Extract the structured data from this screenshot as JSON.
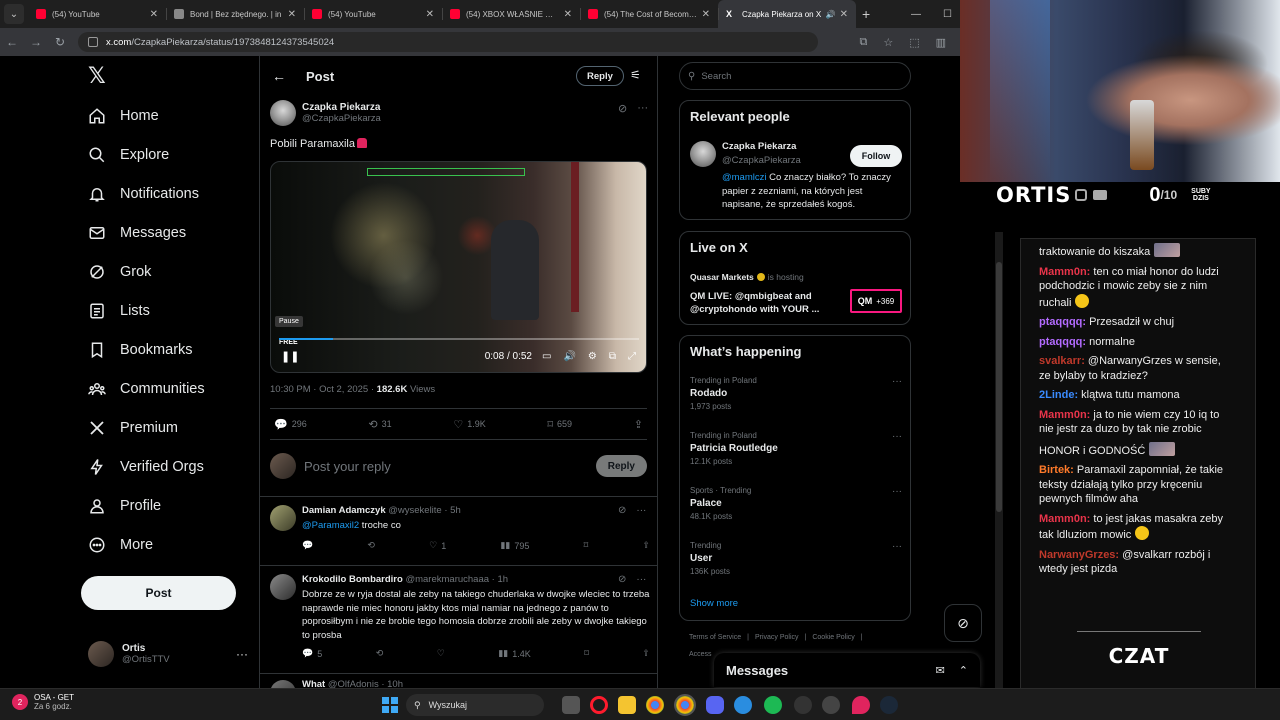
{
  "browser": {
    "tabs": [
      {
        "title": "(54) YouTube",
        "icon": "youtube-icon",
        "active": false
      },
      {
        "title": "Bond | Bez zbędnego. | in",
        "icon": "page-icon",
        "active": false
      },
      {
        "title": "(54) YouTube",
        "icon": "youtube-icon",
        "active": false
      },
      {
        "title": "(54) XBOX WŁAŚNIE WZM",
        "icon": "youtube-icon",
        "active": false
      },
      {
        "title": "(54) The Cost of Becoming",
        "icon": "youtube-icon",
        "active": false
      },
      {
        "title": "Czapka Piekarza on X",
        "icon": "x-icon",
        "active": true
      }
    ],
    "url_host": "x.com",
    "url_path": "/CzapkaPiekarza/status/1973848124373545024"
  },
  "nav": {
    "items": [
      {
        "label": "Home",
        "icon": "home-icon"
      },
      {
        "label": "Explore",
        "icon": "search-icon"
      },
      {
        "label": "Notifications",
        "icon": "bell-icon"
      },
      {
        "label": "Messages",
        "icon": "mail-icon"
      },
      {
        "label": "Grok",
        "icon": "grok-icon"
      },
      {
        "label": "Lists",
        "icon": "list-icon"
      },
      {
        "label": "Bookmarks",
        "icon": "bookmark-icon"
      },
      {
        "label": "Communities",
        "icon": "communities-icon"
      },
      {
        "label": "Premium",
        "icon": "x-icon"
      },
      {
        "label": "Verified Orgs",
        "icon": "lightning-icon"
      },
      {
        "label": "Profile",
        "icon": "person-icon"
      },
      {
        "label": "More",
        "icon": "more-circle-icon"
      }
    ],
    "post_button": "Post",
    "account": {
      "name": "Ortis",
      "handle": "@OrtisTTV"
    }
  },
  "main": {
    "title": "Post",
    "reply_button": "Reply",
    "author": {
      "name": "Czapka Piekarza",
      "handle": "@CzapkaPiekarza"
    },
    "text": "Pobili Paramaxila",
    "video": {
      "tooltip": "Pause",
      "time": "0:08 / 0:52",
      "progress": 0.15,
      "tag": "FREE"
    },
    "meta": {
      "time": "10:30 PM · Oct 2, 2025 · ",
      "views": "182.6K",
      "views_label": " Views"
    },
    "stats": {
      "replies": "296",
      "reposts": "31",
      "likes": "1.9K",
      "bookmarks": "659"
    },
    "composer": {
      "placeholder": "Post your reply",
      "button": "Reply"
    },
    "replies": [
      {
        "name": "Damian Adamczyk",
        "handle": "@wysekelite · 5h",
        "mention": "@Paramaxil2",
        "text": " troche co",
        "likes": "1",
        "views": "795"
      },
      {
        "name": "Krokodilo Bombardiro",
        "handle": "@marekmaruchaaa · 1h",
        "text": "Dobrze ze w ryja dostal ale zeby na takiego chuderlaka w dwojke wleciec to trzeba naprawde nie miec honoru jakby ktos mial namiar na jednego z panów to poprosiłbym i nie ze brobie tego homosia dobrze zrobili ale zeby w dwojke takiego to prosba",
        "replies": "5",
        "views": "1.4K"
      },
      {
        "name": "What",
        "handle": "@OlfAdonis · 10h"
      }
    ]
  },
  "sidebar": {
    "search_placeholder": "Search",
    "relevant": {
      "title": "Relevant people",
      "name": "Czapka Piekarza",
      "handle": "@CzapkaPiekarza",
      "follow": "Follow",
      "bio_mention": "@mamlczi",
      "bio": " Co znaczy białko? To znaczy papier z zezniami, na których jest napisane, że sprzedałeś kogoś."
    },
    "live": {
      "title": "Live on X",
      "host": "Quasar Markets",
      "host_suffix": " is hosting",
      "stream_title": "QM LIVE: @qmbigbeat and @cryptohondo with YOUR ...",
      "listeners": "+369",
      "badge": "QM"
    },
    "happening": {
      "title": "What’s happening",
      "trends": [
        {
          "context": "Trending in Poland",
          "name": "Rodado",
          "count": "1,973 posts"
        },
        {
          "context": "Trending in Poland",
          "name": "Patricia Routledge",
          "count": "12.1K posts"
        },
        {
          "context": "Sports · Trending",
          "name": "Palace",
          "count": "48.1K posts"
        },
        {
          "context": "Trending",
          "name": "User",
          "count": "136K posts"
        }
      ],
      "show_more": "Show more"
    },
    "footer": [
      "Terms of Service",
      "|",
      "Privacy Policy",
      "|",
      "Cookie Policy",
      "|"
    ],
    "footer2": "Access"
  },
  "messages_drawer": {
    "title": "Messages"
  },
  "taskbar": {
    "notify_title": "OSA - GET",
    "notify_sub": "Za 6 godz.",
    "notify_count": "2",
    "search": "Wyszukaj"
  },
  "stream": {
    "name": "ORTIS",
    "subs": "0",
    "goal": "/10",
    "subs_label_1": "SUBY",
    "subs_label_2": "DZIS",
    "chat_title": "CZAT",
    "chat": [
      {
        "user": "",
        "text": "traktowanie do kiszaka",
        "color": "#ffffff",
        "emote": true
      },
      {
        "user": "Mamm0n:",
        "text": " ten co miał honor do ludzi podchodzic i mowic zeby sie z nim ruchali",
        "color": "#e8344a",
        "emo": true
      },
      {
        "user": "ptaqqqq:",
        "text": " Przesadził w chuj",
        "color": "#b36bff"
      },
      {
        "user": "ptaqqqq:",
        "text": " normalne",
        "color": "#b36bff"
      },
      {
        "user": "svalkarr:",
        "text": " @NarwanyGrzes w sensie, ze bylaby to kradziez?",
        "color": "#c0392b"
      },
      {
        "user": "2Linde:",
        "text": " klątwa tutu mamona",
        "color": "#3a8bff"
      },
      {
        "user": "Mamm0n:",
        "text": " ja to nie wiem czy 10 iq to nie jestr za duzo by tak nie zrobic",
        "color": "#e8344a"
      },
      {
        "user": "",
        "text": "HONOR i GODNOŚĆ",
        "color": "#ffffff",
        "emote": true
      },
      {
        "user": "Birtek:",
        "text": " Paramaxil zapomniał, że takie teksty działają tylko przy kręceniu pewnych filmów aha",
        "color": "#ff7a2a"
      },
      {
        "user": "Mamm0n:",
        "text": " to jest jakas masakra zeby tak ldluziom mowic",
        "color": "#e8344a",
        "emo": true
      },
      {
        "user": "NarwanyGrzes:",
        "text": " @svalkarr rozbój i wtedy jest pizda",
        "color": "#c0392b"
      }
    ]
  },
  "colors": {
    "accent": "#1d9bf0",
    "bg": "#000000",
    "border": "#2f3336",
    "muted": "#71767b"
  }
}
